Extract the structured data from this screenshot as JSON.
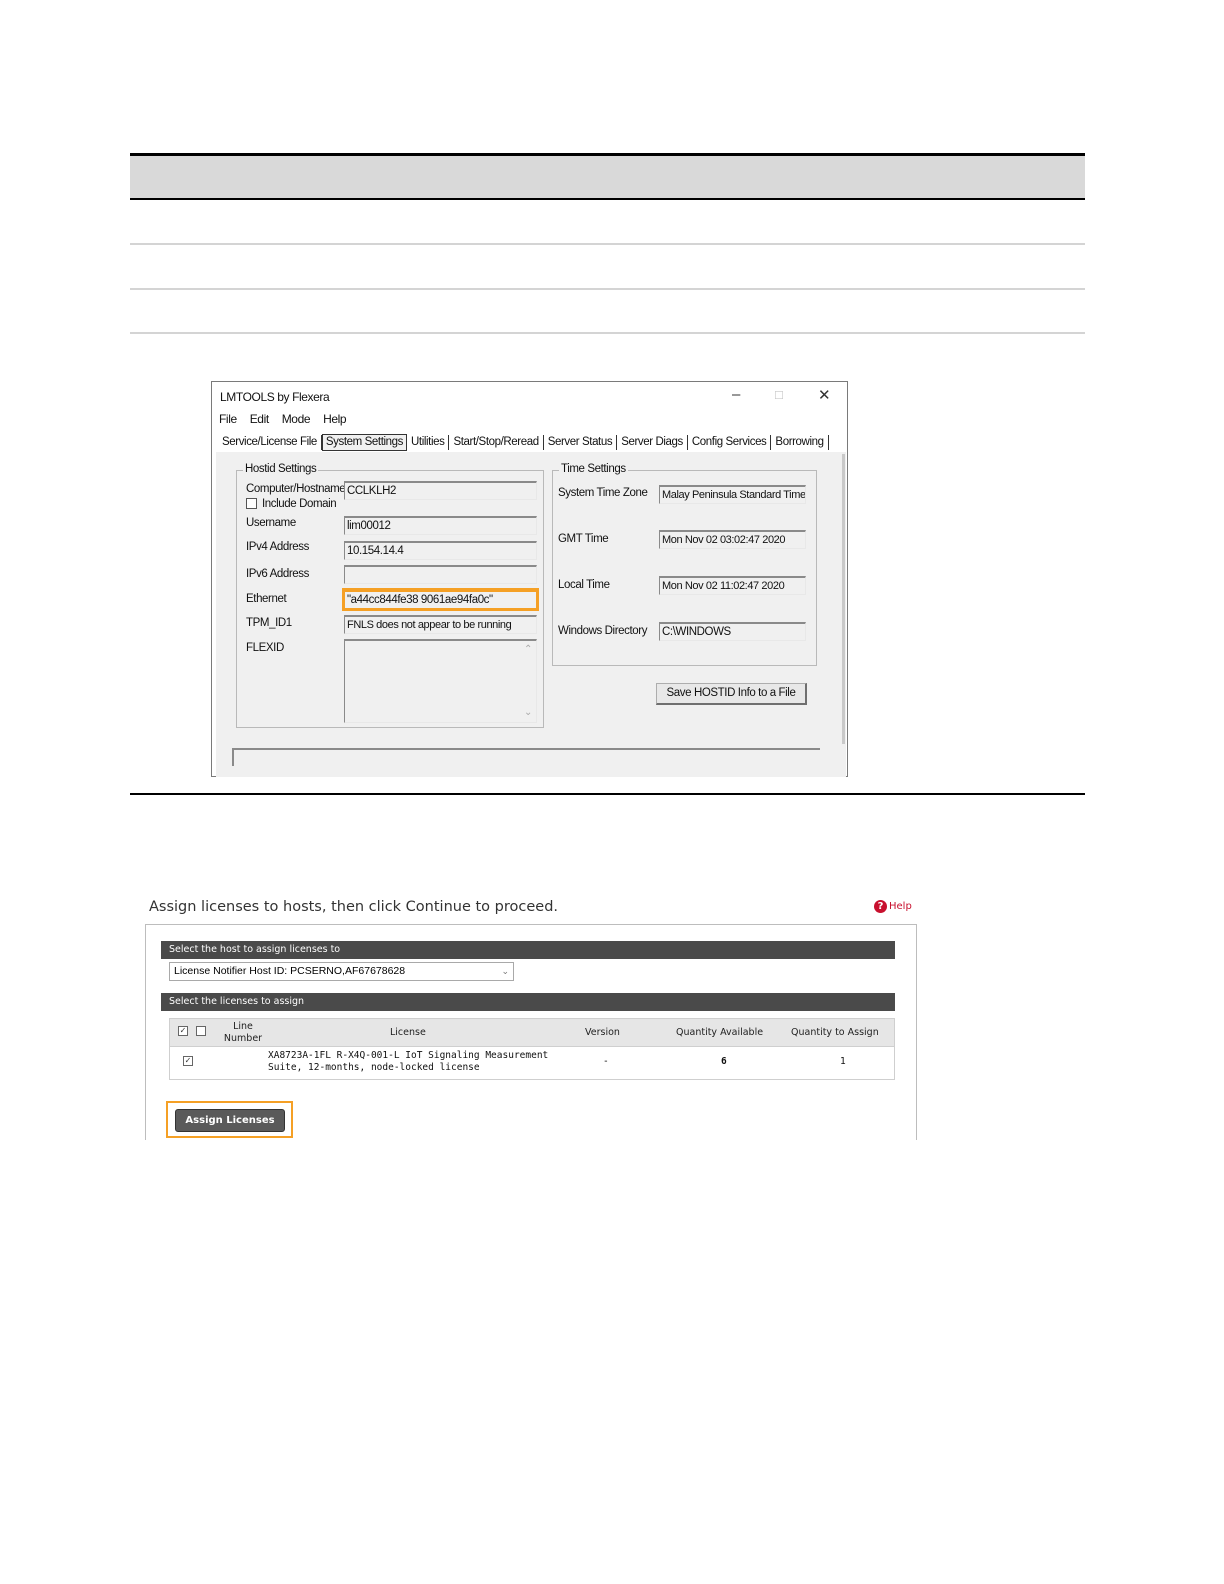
{
  "lmtools": {
    "title": "LMTOOLS by Flexera",
    "menu": [
      "File",
      "Edit",
      "Mode",
      "Help"
    ],
    "tabs": [
      "Service/License File",
      "System Settings",
      "Utilities",
      "Start/Stop/Reread",
      "Server Status",
      "Server Diags",
      "Config Services",
      "Borrowing"
    ],
    "active_tab": "System Settings",
    "hostid_settings": {
      "group_title": "Hostid Settings",
      "computer_hostname_label": "Computer/Hostname",
      "computer_hostname_value": "CCLKLH2",
      "include_domain_label": "Include Domain",
      "username_label": "Username",
      "username_value": "lim00012",
      "ipv4_label": "IPv4 Address",
      "ipv4_value": "10.154.14.4",
      "ipv6_label": "IPv6 Address",
      "ipv6_value": "",
      "ethernet_label": "Ethernet",
      "ethernet_value": "\"a44cc844fe38 9061ae94fa0c\"",
      "tpm_label": "TPM_ID1",
      "tpm_value": "FNLS does not appear to be running",
      "flexid_label": "FLEXID"
    },
    "time_settings": {
      "group_title": "Time Settings",
      "system_time_zone_label": "System Time Zone",
      "system_time_zone_value": "Malay Peninsula Standard Time",
      "gmt_label": "GMT Time",
      "gmt_value": "Mon Nov 02 03:02:47 2020",
      "local_label": "Local Time",
      "local_value": "Mon Nov 02 11:02:47 2020",
      "windir_label": "Windows Directory",
      "windir_value": "C:\\WINDOWS"
    },
    "save_button": "Save HOSTID Info to a File"
  },
  "assign": {
    "heading": "Assign licenses to hosts, then click Continue to proceed.",
    "help": "Help",
    "host_bar": "Select the host to assign licenses to",
    "host_select": "License Notifier Host ID: PCSERNO,AF67678628",
    "licenses_bar": "Select the licenses to assign",
    "columns": {
      "line_number": "Line Number",
      "license": "License",
      "version": "Version",
      "qty_available": "Quantity Available",
      "qty_assign": "Quantity to Assign"
    },
    "row": {
      "license_line1": "XA8723A-1FL R-X4Q-001-L IoT Signaling Measurement",
      "license_line2": "Suite, 12-months, node-locked license",
      "version": "-",
      "qty_available": "6",
      "qty_assign": "1"
    },
    "assign_button": "Assign Licenses"
  }
}
